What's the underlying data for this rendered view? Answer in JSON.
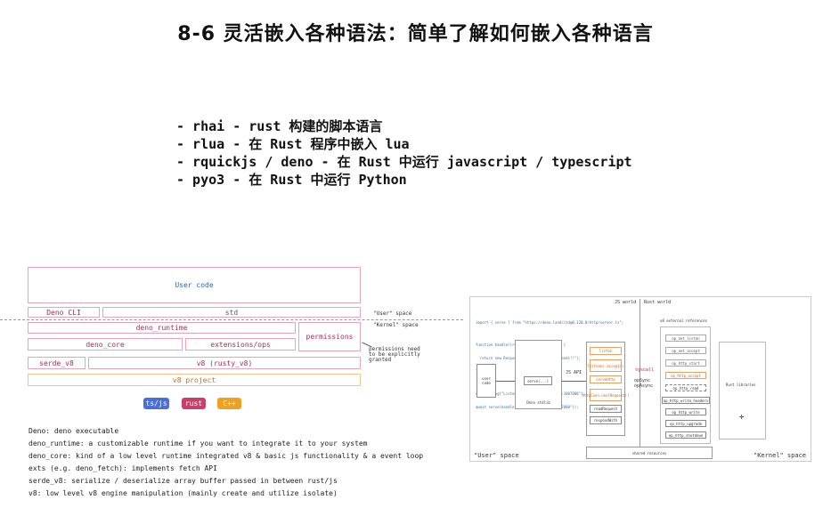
{
  "slide": {
    "title": "8-6 灵活嵌入各种语法：简单了解如何嵌入各种语言",
    "bullets": [
      "- rhai - rust 构建的脚本语言",
      "- rlua - 在 Rust 程序中嵌入 lua",
      "- rquickjs / deno - 在 Rust 中运行 javascript / typescript",
      "- pyo3 - 在 Rust 中运行 Python"
    ]
  },
  "deno_diagram": {
    "user_code": "User code",
    "deno_cli": "Deno CLI",
    "std": "std",
    "user_space": "\"User\" space",
    "kernel_space": "\"Kernel\" space",
    "deno_runtime": "deno_runtime",
    "permissions": "permissions",
    "permissions_note": [
      "permissions need",
      "to be explicitly",
      "granted"
    ],
    "deno_core": "deno_core",
    "extensions": "extensions/ops",
    "serde_v8": "serde_v8",
    "v8_rusty": "v8 (rusty_v8)",
    "v8_project": "v8 project",
    "legend": [
      {
        "label": "ts/js",
        "color": "#4a6fd8"
      },
      {
        "label": "rust",
        "color": "#c8406a"
      },
      {
        "label": "C++",
        "color": "#f0a020"
      }
    ],
    "descriptions": [
      "Deno: deno executable",
      "deno_runtime: a customizable runtime if you want to integrate it to your system",
      "deno_core: kind of a low level runtime integrated v8 & basic js functionality & a event loop",
      "exts (e.g. deno_fetch): implements fetch API",
      "serde_v8: serialize / deserialize array buffer passed in between rust/js",
      "v8: low level v8 engine manipulation (mainly create and utilize isolate)"
    ]
  },
  "runtime_diagram": {
    "js_world": "JS world",
    "rust_world": "Rust world",
    "code_lines": [
      "import { serve } from \"https://deno.land/std@0.120.0/http/server.ts\";",
      "",
      "function handler(req: Request): Response {",
      "  return new Response(\"Hello My dear friends!!\");",
      "}",
      "",
      "console.log(\"Listening on http://1.2.3.4:1007000\");",
      "await serve(handler, {addr: \"1.2.3.4:1007000\"});"
    ],
    "user_code": "user code",
    "serve_fn": "serve(...)",
    "deno_stdlib": "Deno stdlib",
    "js_api": "JS API",
    "ops": [
      "listen",
      "listener.accept()",
      "serveHttp",
      "httpConn.nextRequest()",
      "readRequest",
      "respondWith"
    ],
    "syscall": "syscall",
    "op_sync": "opSync",
    "op_async": "opAsync",
    "v8_refs": "v8 external references",
    "op_refs": [
      "op_net_listen",
      "op_net_accept",
      "op_http_start",
      "op_http_accept",
      "op_http_read",
      "op_http_write_headers",
      "op_http_write",
      "op_http_upgrade",
      "op_http_shutdown"
    ],
    "rust_libs": "Rust libraries",
    "shared": "shared resources",
    "user_space": "\"User\" space",
    "kernel_space": "\"Kernel\" space"
  }
}
